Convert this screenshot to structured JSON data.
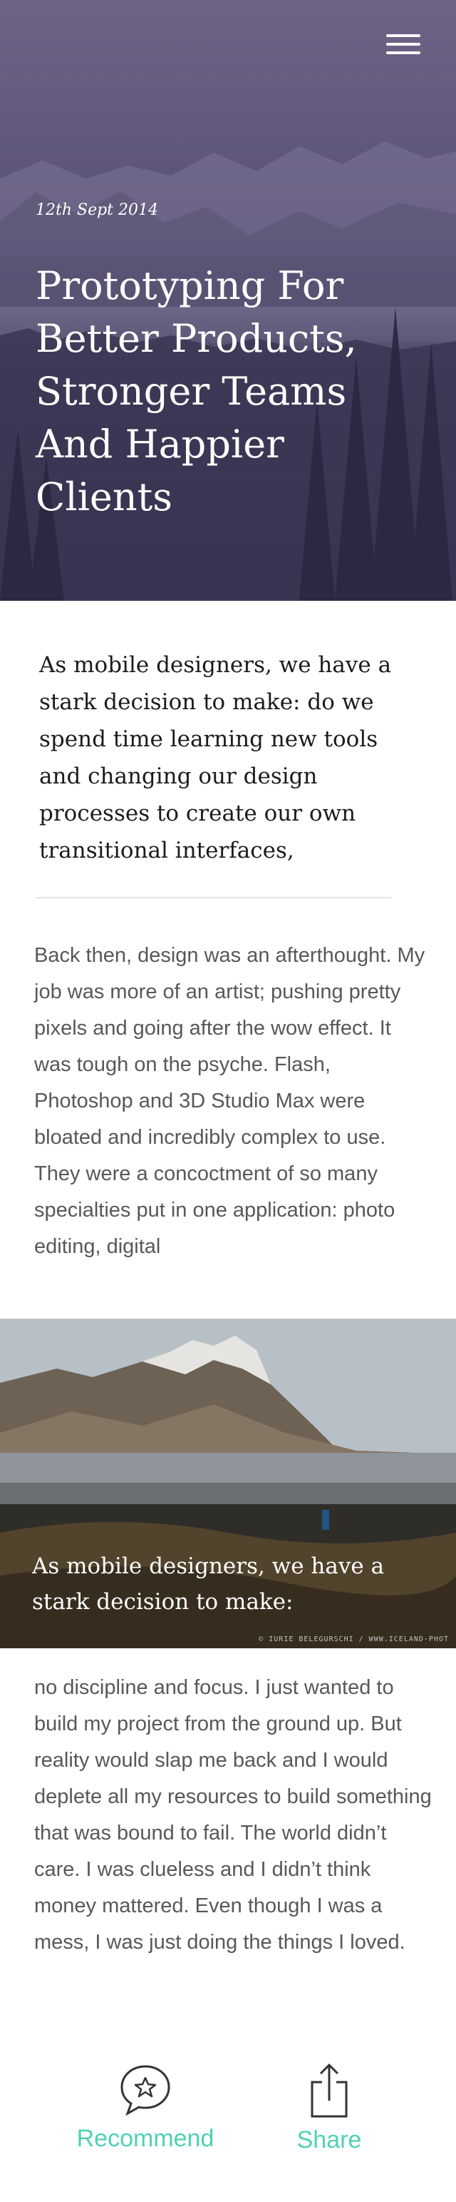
{
  "hero": {
    "date": "12th Sept 2014",
    "title": "Prototyping For Better Products, Stronger Teams And Happier Clients",
    "menu_icon": "hamburger-menu-icon"
  },
  "article": {
    "lede": "As mobile designers, we have a stark decision to make: do we spend time learning new tools and changing our design processes to create our own transitional interfaces,",
    "paragraph_1": "Back then, design was an afterthought. My job was more of an artist; pushing pretty pixels and going after the wow effect. It was tough on the psyche. Flash, Photoshop and 3D Studio Max were bloated and incredibly complex to use. They were a concoctment of so many specialties put in one application: photo editing, digital",
    "feature_caption": "As mobile designers, we have a stark decision to make:",
    "photo_credit": "© IURIE BELEGURSCHI / WWW.ICELAND-PHOT",
    "paragraph_2": "no discipline and focus. I just wanted to build my project from the ground up. But reality would slap me back and I would deplete all my resources to build something that was bound to fail. The world didn’t care. I was clueless and I didn’t think money mattered. Even though I was a mess, I was just doing the things I loved."
  },
  "actions": {
    "recommend_label": "Recommend",
    "recommend_icon": "speech-bubble-star-icon",
    "share_label": "Share",
    "share_icon": "share-icon"
  },
  "colors": {
    "accent": "#4fd1b5",
    "hero_overlay": "#5d5578",
    "heading_text": "#1c1c1c",
    "body_text": "#585858"
  }
}
